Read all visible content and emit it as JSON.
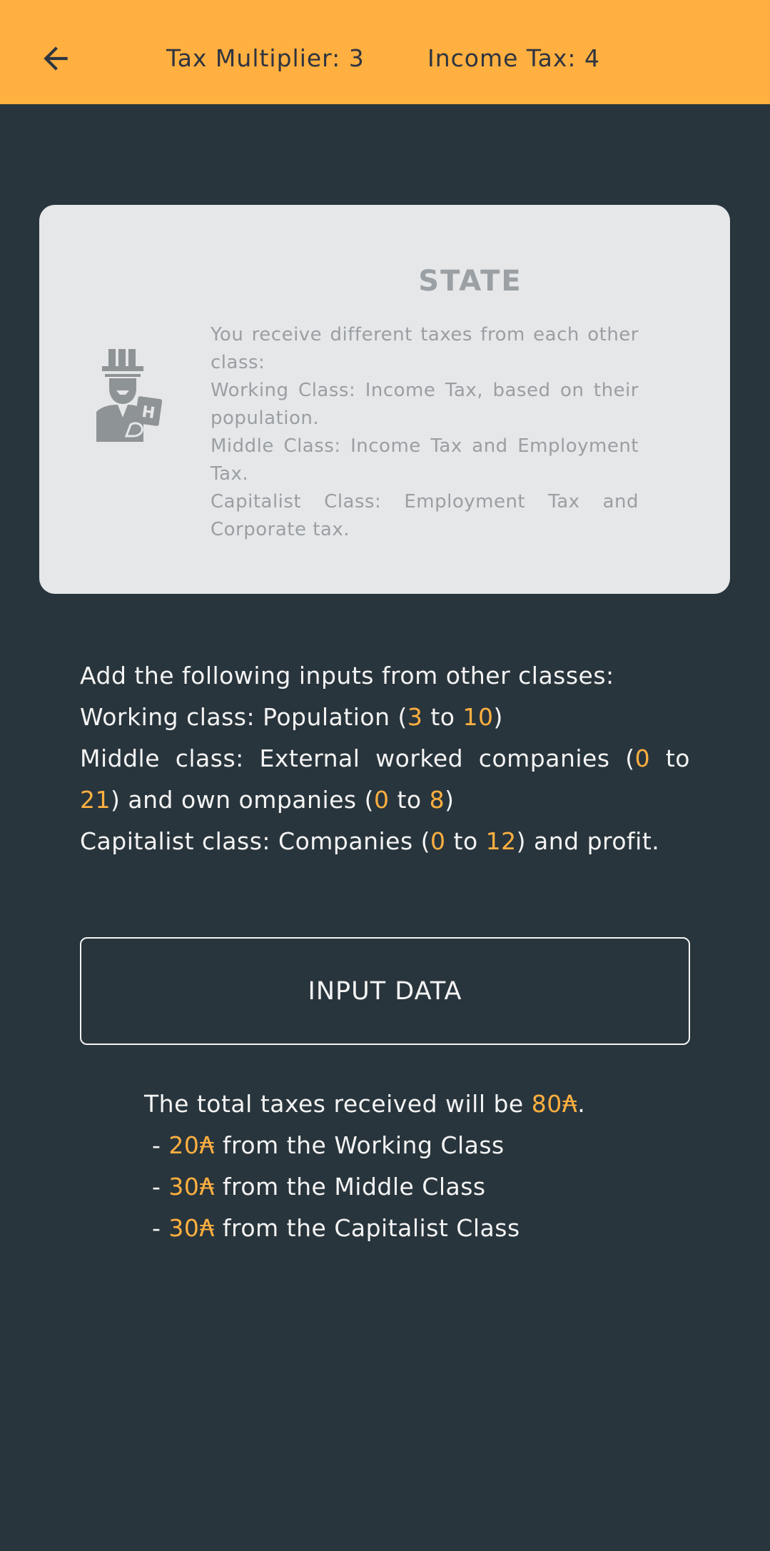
{
  "header": {
    "back_icon": "arrow-left-icon",
    "tax_multiplier_label": "Tax Multiplier: 3",
    "income_tax_label": "Income Tax: 4"
  },
  "card": {
    "title": "STATE",
    "icon": "uncle-sam-state-icon",
    "lines": [
      "You receive different taxes from each other class:",
      "Working Class: Income Tax, based on their population.",
      "Middle Class: Income Tax and Employment Tax.",
      "Capitalist Class: Employment Tax and Corporate tax."
    ]
  },
  "inputs_desc": {
    "intro": "Add the following inputs from other classes:",
    "working": {
      "prefix": "Working class: Population (",
      "min": "3",
      "to": " to ",
      "max": "10",
      "suffix": ")"
    },
    "middle": {
      "prefix": "Middle class: External worked companies (",
      "min1": "0",
      "to1": " to ",
      "max1": "21",
      "mid": ") and own ompanies (",
      "min2": "0",
      "to2": " to ",
      "max2": "8",
      "suffix": ")"
    },
    "capitalist": {
      "prefix": "Capitalist class: Companies (",
      "min": "0",
      "to": " to ",
      "max": "12",
      "suffix": ") and profit."
    }
  },
  "input_button_label": "INPUT DATA",
  "result": {
    "total_prefix": "The total taxes received will be ",
    "total_value": "80₳",
    "total_suffix": ".",
    "rows": [
      {
        "dash": " - ",
        "value": "20₳",
        "label": " from the Working Class"
      },
      {
        "dash": " - ",
        "value": "30₳",
        "label": " from the Middle Class"
      },
      {
        "dash": " - ",
        "value": "30₳",
        "label": " from the Capitalist Class"
      }
    ]
  },
  "colors": {
    "header_bg": "#ffb040",
    "page_bg": "#29353c",
    "card_bg": "#e6e7e9",
    "accent": "#ffb040"
  }
}
